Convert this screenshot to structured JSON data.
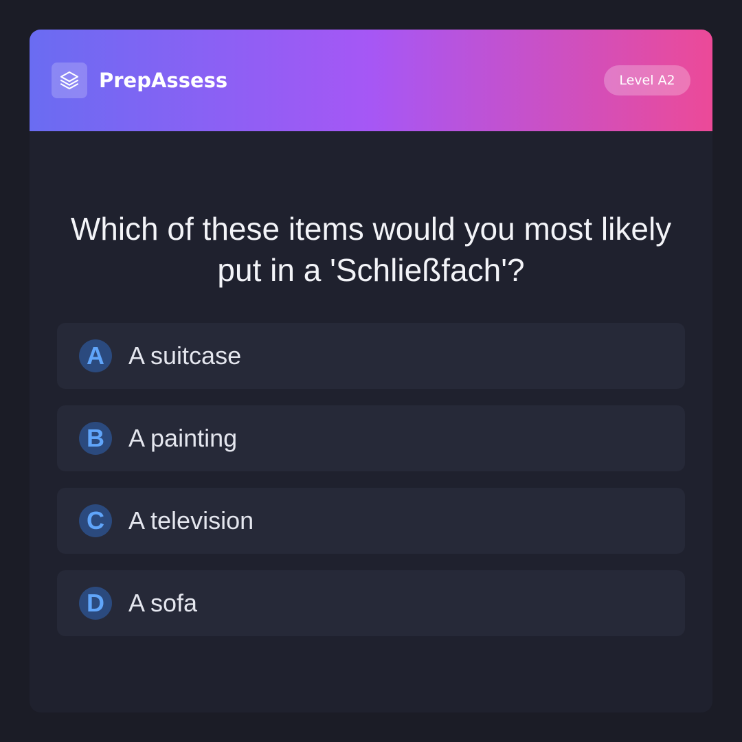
{
  "header": {
    "logo_icon": "layers-icon",
    "brand": "PrepAssess",
    "level_badge": "Level A2",
    "gradient_colors": [
      "#6a6cf2",
      "#a657f5",
      "#ec4a98"
    ]
  },
  "question": {
    "text": "Which of these items would you most likely put in a 'Schließfach'?"
  },
  "options": [
    {
      "letter": "A",
      "text": "A suitcase"
    },
    {
      "letter": "B",
      "text": "A painting"
    },
    {
      "letter": "C",
      "text": "A television"
    },
    {
      "letter": "D",
      "text": "A sofa"
    }
  ],
  "colors": {
    "background": "#1b1c26",
    "card": "#1f212e",
    "option": "#262938",
    "letter_bg": "#2b4a7e",
    "letter_fg": "#60a5fa"
  }
}
